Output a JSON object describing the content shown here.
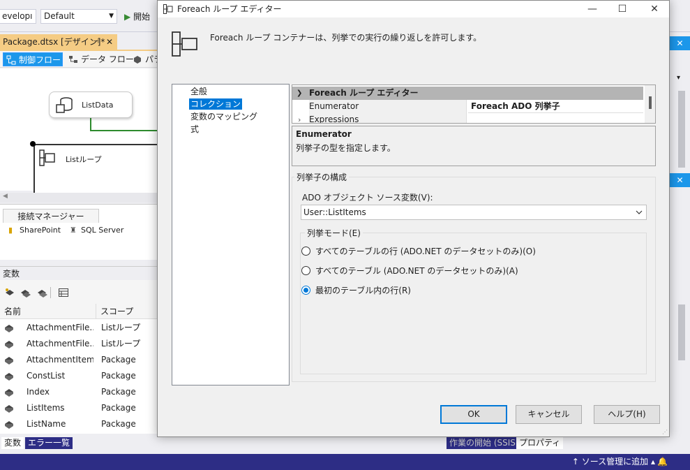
{
  "ide": {
    "toolbar": {
      "config_combo": "evelopı",
      "platform_combo": "Default",
      "start_label": "開始"
    },
    "doc_tab": {
      "title": "Package.dtsx [デザイン]*",
      "pin": "⊣",
      "close": "✕"
    },
    "designer_tabs": [
      "制御フロー",
      "データ フロー",
      "パラ"
    ],
    "canvas": {
      "listdata": "ListData",
      "listloop": "Listループ"
    },
    "connection_managers": {
      "title": "接続マネージャー",
      "items": [
        "SharePoint",
        "SQL Server"
      ]
    },
    "variables": {
      "title": "変数",
      "headers": [
        "名前",
        "スコープ"
      ],
      "rows": [
        {
          "name": "AttachmentFile...",
          "scope": "Listループ"
        },
        {
          "name": "AttachmentFile...",
          "scope": "Listループ"
        },
        {
          "name": "AttachmentItems",
          "scope": "Package"
        },
        {
          "name": "ConstList",
          "scope": "Package"
        },
        {
          "name": "Index",
          "scope": "Package"
        },
        {
          "name": "ListItems",
          "scope": "Package"
        },
        {
          "name": "ListName",
          "scope": "Package"
        }
      ]
    },
    "bottom_tabs": {
      "variables": "変数",
      "errors": "エラー一覧",
      "getting_started": "作業の開始 (SSIS)",
      "properties": "プロパティ"
    },
    "status": {
      "source_control": "ソース管理に追加"
    },
    "right_panel": {
      "close1": "✕",
      "close2": "✕"
    }
  },
  "dialog": {
    "title": "Foreach ループ エディター",
    "description": "Foreach ループ コンテナーは、列挙での実行の繰り返しを許可します。",
    "nav_items": [
      "全般",
      "コレクション",
      "変数のマッピング",
      "式"
    ],
    "selected_nav": "コレクション",
    "property_grid": {
      "category": "Foreach ループ エディター",
      "rows": [
        {
          "name": "Enumerator",
          "value": "Foreach ADO 列挙子"
        },
        {
          "name": "Expressions",
          "value": ""
        }
      ]
    },
    "help": {
      "title": "Enumerator",
      "text": "列挙子の型を指定します。"
    },
    "enumerator_config": {
      "group_title": "列挙子の構成",
      "source_label": "ADO オブジェクト ソース変数(V):",
      "source_value": "User::ListItems",
      "mode_title": "列挙モード(E)",
      "modes": [
        {
          "label": "すべてのテーブルの行 (ADO.NET のデータセットのみ)(O)",
          "selected": false
        },
        {
          "label": "すべてのテーブル (ADO.NET のデータセットのみ)(A)",
          "selected": false
        },
        {
          "label": "最初のテーブル内の行(R)",
          "selected": true
        }
      ]
    },
    "buttons": {
      "ok": "OK",
      "cancel": "キャンセル",
      "help": "ヘルプ(H)"
    },
    "accent_color": "#0078d7"
  }
}
